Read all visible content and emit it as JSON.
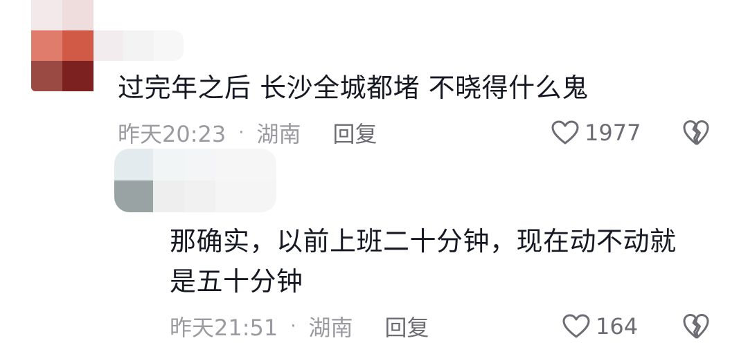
{
  "comments": [
    {
      "text": "过完年之后 长沙全城都堵 不晓得什么鬼",
      "time": "昨天20:23",
      "separator": "·",
      "location": "湖南",
      "reply_label": "回复",
      "likes": "1977",
      "icons": {
        "like": "heart-outline-icon",
        "dislike": "broken-heart-icon"
      }
    },
    {
      "text_line1": "那确实，以前上班二十分钟，现在动不动就",
      "text_line2": "是五十分钟",
      "time": "昨天21:51",
      "separator": "·",
      "location": "湖南",
      "reply_label": "回复",
      "likes": "164",
      "icons": {
        "like": "heart-outline-icon",
        "dislike": "broken-heart-icon"
      }
    }
  ],
  "colors": {
    "text": "#161823",
    "meta": "#9a9aa0",
    "reply": "#6c6c74"
  }
}
